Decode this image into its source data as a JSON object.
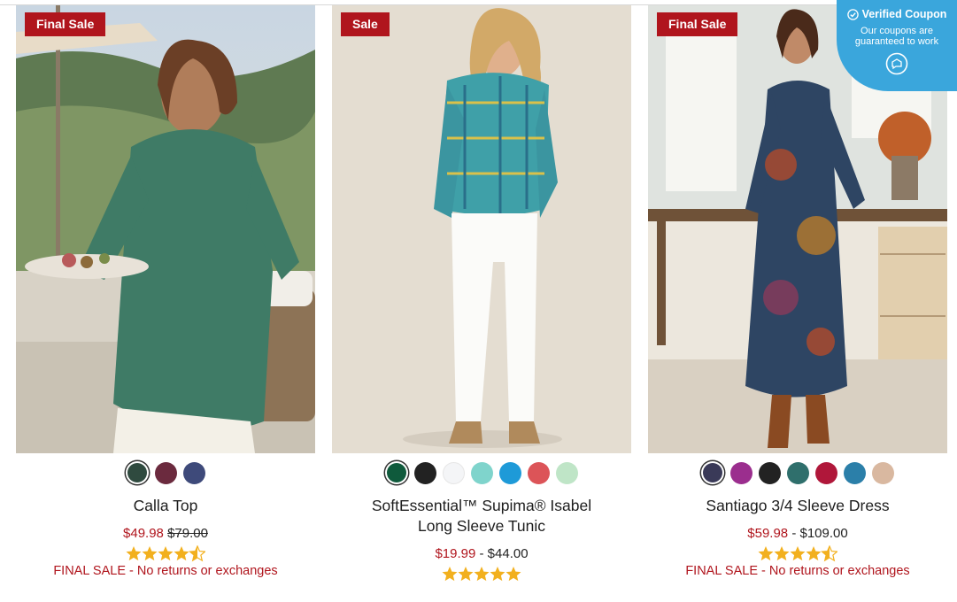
{
  "products": [
    {
      "badge": "Final Sale",
      "name": "Calla Top",
      "sale_price": "$49.98",
      "original_price": "$79.00",
      "rating": 4.5,
      "note": "FINAL SALE - No returns or exchanges",
      "swatches": [
        "#2f4a3f",
        "#6b2a3e",
        "#3e4a7a"
      ],
      "selected_swatch": 0
    },
    {
      "badge": "Sale",
      "name": "SoftEssential™ Supima® Isabel Long Sleeve Tunic",
      "sale_price": "$19.99",
      "separator": "-",
      "regular_price": "$44.00",
      "rating": 5,
      "swatches": [
        "#0f5a3c",
        "#222222",
        "#f4f5f7",
        "#7fd4cc",
        "#1e9ad8",
        "#dc5458",
        "#bfe5c7"
      ],
      "selected_swatch": 0
    },
    {
      "badge": "Final Sale",
      "name": "Santiago 3/4 Sleeve Dress",
      "sale_price": "$59.98",
      "separator": "-",
      "regular_price": "$109.00",
      "rating": 4.5,
      "note": "FINAL SALE - No returns or exchanges",
      "swatches": [
        "#3a3a58",
        "#9b2e8e",
        "#222222",
        "#2f6f6c",
        "#b0173a",
        "#2b7fa9",
        "#d9b8a0"
      ],
      "selected_swatch": 0
    }
  ],
  "coupon": {
    "title": "Verified Coupon",
    "subtitle_line1": "Our coupons are",
    "subtitle_line2": "guaranteed to work"
  },
  "colors": {
    "badge": "#b0151d",
    "sale_text": "#b0151d",
    "star": "#f2b01e",
    "coupon_bg": "#3aa6dc"
  }
}
